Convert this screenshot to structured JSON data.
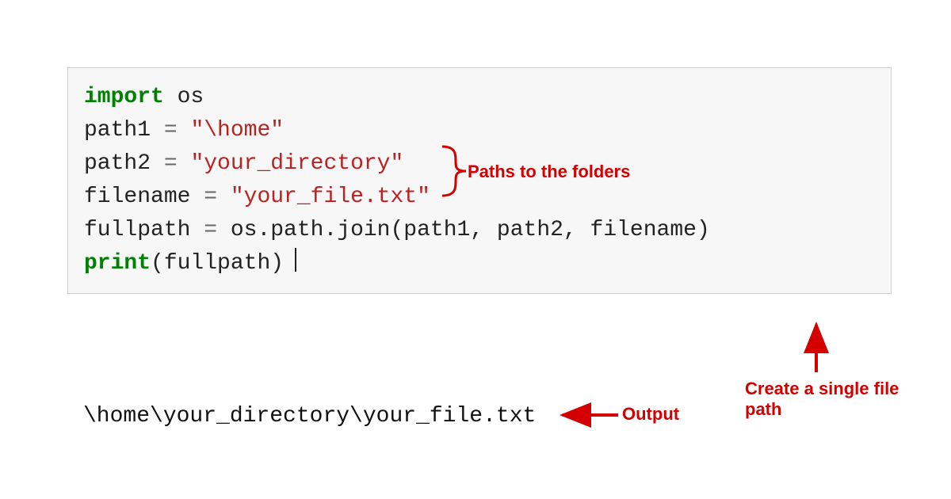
{
  "code": {
    "line1": {
      "kw": "import",
      "mod": " os"
    },
    "blank1": "",
    "line3": {
      "var": "path1 ",
      "op": "=",
      "str": " \"\\home\""
    },
    "line4": {
      "var": "path2 ",
      "op": "=",
      "str": " \"your_directory\""
    },
    "line5": {
      "var": "filename ",
      "op": "=",
      "str": " \"your_file.txt\""
    },
    "blank2": "",
    "line7": {
      "lhs": "fullpath ",
      "op": "=",
      "rhs": " os.path.join(path1, path2, filename)"
    },
    "line8": {
      "fn": "print",
      "args": "(fullpath)"
    }
  },
  "output": "\\home\\your_directory\\your_file.txt",
  "annotations": {
    "paths": "Paths to the folders",
    "create": "Create a single file\npath",
    "output": "Output"
  },
  "colors": {
    "annotation": "#d40000",
    "keyword": "#008000",
    "string": "#ba2121",
    "code_bg": "#f7f7f7",
    "code_border": "#cfcfcf"
  }
}
